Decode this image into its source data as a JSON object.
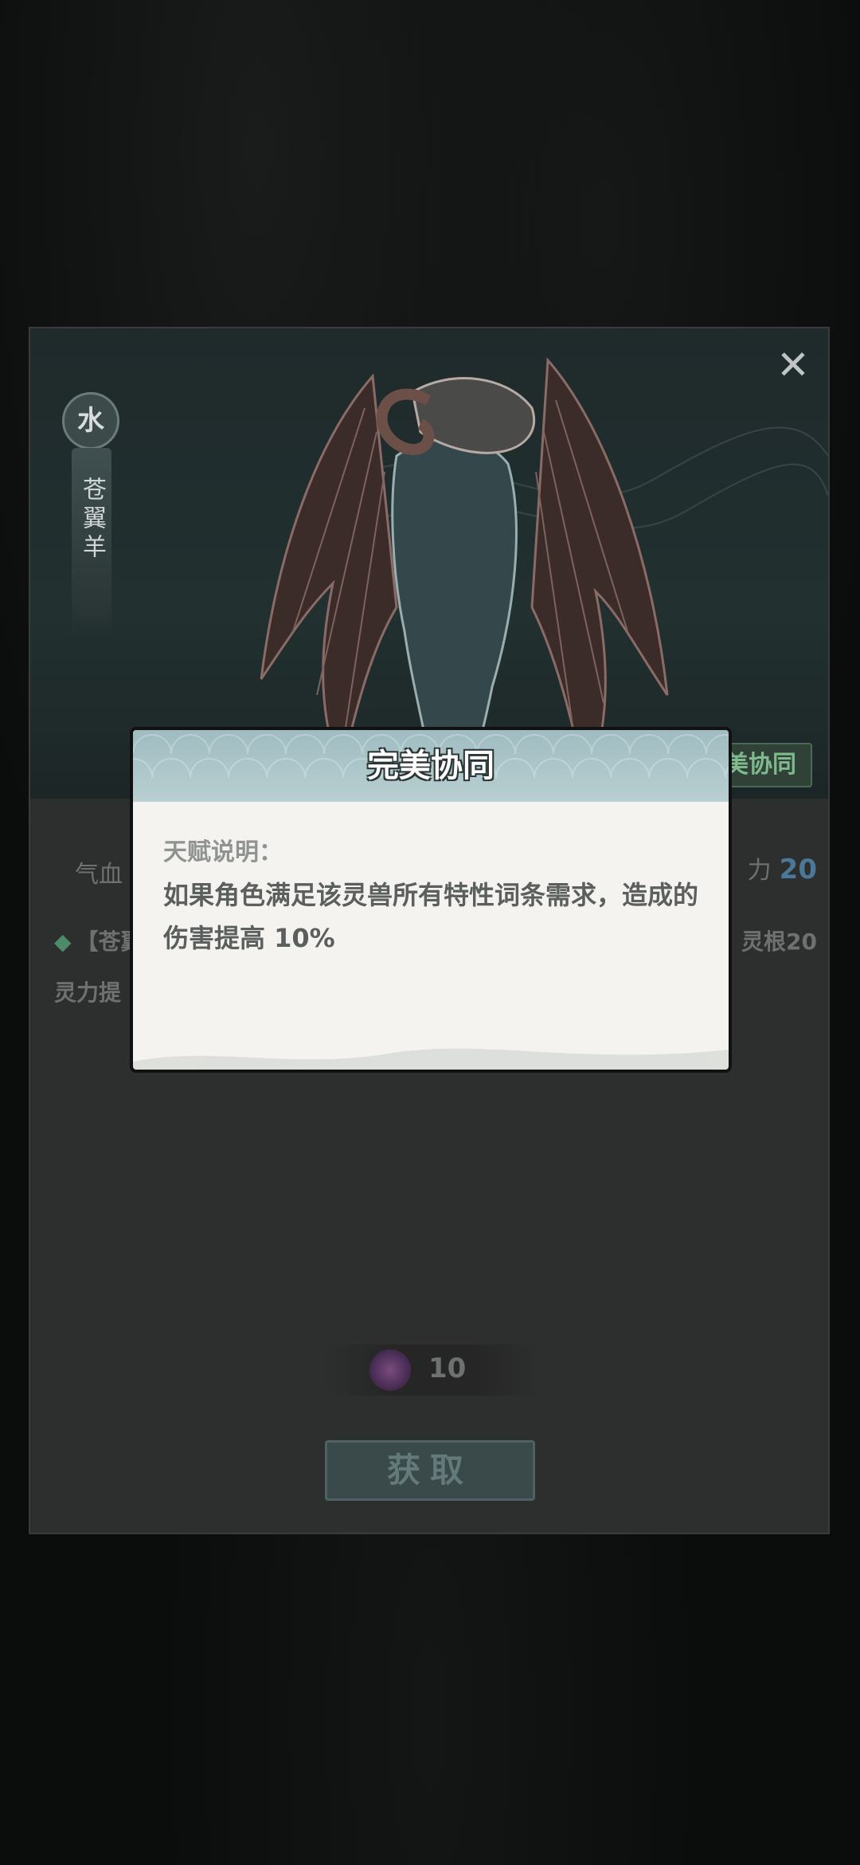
{
  "card": {
    "element": "水",
    "name": "苍翼羊",
    "tag": "美协同",
    "stat_left": "气血",
    "stat_right_label": "力",
    "stat_right_value": "20",
    "trait_start": "【苍翼",
    "trait_right": "灵根20",
    "trait_line2": "灵力提",
    "close_icon": "✕"
  },
  "purchase": {
    "cost": "10",
    "button_label": "获取"
  },
  "modal": {
    "title": "完美协同",
    "subtitle": "天赋说明：",
    "description": "如果角色满足该灵兽所有特性词条需求，造成的伤害提高 10%"
  },
  "colors": {
    "accent_green": "#7fb98d",
    "accent_blue": "#4a7896",
    "modal_header": "#9fbcc0"
  }
}
